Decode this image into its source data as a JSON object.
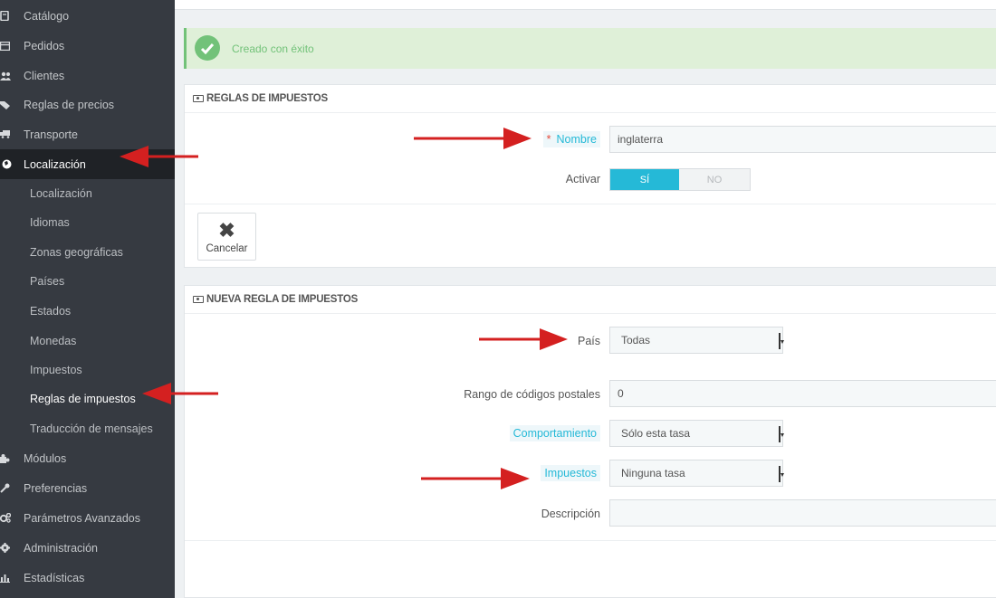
{
  "sidebar": {
    "items": [
      {
        "label": "Catálogo",
        "icon": "catalog-icon"
      },
      {
        "label": "Pedidos",
        "icon": "orders-icon"
      },
      {
        "label": "Clientes",
        "icon": "customers-icon"
      },
      {
        "label": "Reglas de precios",
        "icon": "price-rules-icon"
      },
      {
        "label": "Transporte",
        "icon": "truck-icon"
      },
      {
        "label": "Localización",
        "icon": "globe-icon"
      }
    ],
    "subitems": [
      {
        "label": "Localización"
      },
      {
        "label": "Idiomas"
      },
      {
        "label": "Zonas geográficas"
      },
      {
        "label": "Países"
      },
      {
        "label": "Estados"
      },
      {
        "label": "Monedas"
      },
      {
        "label": "Impuestos"
      },
      {
        "label": "Reglas de impuestos"
      },
      {
        "label": "Traducción de mensajes"
      }
    ],
    "lower_items": [
      {
        "label": "Módulos",
        "icon": "puzzle-icon"
      },
      {
        "label": "Preferencias",
        "icon": "wrench-icon"
      },
      {
        "label": "Parámetros Avanzados",
        "icon": "cogs-icon"
      },
      {
        "label": "Administración",
        "icon": "gear-icon"
      },
      {
        "label": "Estadísticas",
        "icon": "bar-chart-icon"
      }
    ]
  },
  "alert": {
    "message": "Creado con éxito"
  },
  "tax_rules_panel": {
    "title": "REGLAS DE IMPUESTOS",
    "name_label": "Nombre",
    "name_value": "inglaterra",
    "active_label": "Activar",
    "toggle_yes": "SÍ",
    "toggle_no": "NO",
    "cancel_label": "Cancelar"
  },
  "new_rule_panel": {
    "title": "NUEVA REGLA DE IMPUESTOS",
    "country_label": "País",
    "country_value": "Todas",
    "zip_label": "Rango de códigos postales",
    "zip_value": "0",
    "behavior_label": "Comportamiento",
    "behavior_value": "Sólo esta tasa",
    "tax_label": "Impuestos",
    "tax_value": "Ninguna tasa",
    "description_label": "Descripción",
    "description_value": ""
  },
  "colors": {
    "sidebar_bg": "#363a41",
    "sidebar_active": "#1f2226",
    "accent": "#25b9d7",
    "success": "#72c279",
    "arrow": "#d42020"
  }
}
